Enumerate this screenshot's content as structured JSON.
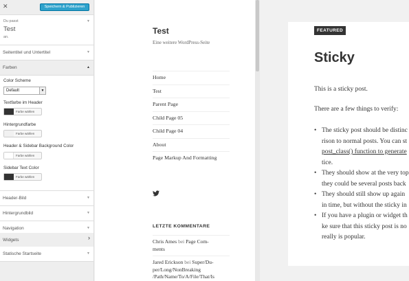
{
  "customizer": {
    "close_glyph": "✕",
    "save_label": "Speichern & Publizieren",
    "info": {
      "pre": "Du passt",
      "title": "Test",
      "sub": "an."
    },
    "sections": [
      {
        "label": "Seitentitel und Untertitel",
        "state": "collapsed"
      },
      {
        "label": "Farben",
        "state": "expanded"
      },
      {
        "label": "Header-Bild",
        "state": "collapsed"
      },
      {
        "label": "Hintergrundbild",
        "state": "collapsed"
      },
      {
        "label": "Navigation",
        "state": "collapsed"
      },
      {
        "label": "Widgets",
        "state": "hover"
      },
      {
        "label": "Statische Startseite",
        "state": "collapsed"
      }
    ],
    "farben": {
      "scheme_label": "Color Scheme",
      "scheme_value": "Default",
      "choose_label": "Farbe wählen",
      "controls": [
        {
          "label": "Textfarbe im Header",
          "color": "#333333"
        },
        {
          "label": "Hintergrundfarbe",
          "color": "#f1f1f1"
        },
        {
          "label": "Header & Sidebar Background Color",
          "color": "#ffffff"
        },
        {
          "label": "Sidebar Text Color",
          "color": "#333333"
        }
      ]
    },
    "icons": {
      "collapsed": "chevron-down-icon",
      "expanded": "chevron-up-icon",
      "hover": "chevron-right-icon"
    }
  },
  "preview": {
    "site_title": "Test",
    "site_description": "Eine weitere WordPress-Seite",
    "menu": [
      "Home",
      "Test",
      "Parent Page",
      "Child Page 05",
      "Child Page 04",
      "About",
      "Page Markup And Formatting"
    ],
    "social_icon": "twitter-icon",
    "widget_title": "LETZTE KOMMENTARE",
    "comments": [
      {
        "author": "Chris Ames",
        "by": "bei",
        "post_lines": [
          "Page Com-",
          "ments"
        ]
      },
      {
        "author": "Jared Erickson",
        "by": "bei",
        "post_lines": [
          "Super/Du-",
          "per/Long/NonBreaking",
          "/Path/Name/To/A/File/That/Is"
        ]
      }
    ],
    "post": {
      "badge": "FEATURED",
      "title": "Sticky",
      "paragraphs": [
        "This is a sticky post.",
        "There are a few things to verify:"
      ],
      "bullets": [
        {
          "lines": [
            "The sticky post should be distinc",
            "rison to normal posts. You can st",
            "post_class() function to generate",
            "tice."
          ]
        },
        {
          "lines": [
            "They should show at the very top",
            "they could be several posts back"
          ]
        },
        {
          "lines": [
            "They should still show up again",
            "in time, but without the sticky in"
          ]
        },
        {
          "lines": [
            "If you have a plugin or widget th",
            "ke sure that this sticky post is no",
            "really is popular."
          ]
        }
      ]
    }
  }
}
